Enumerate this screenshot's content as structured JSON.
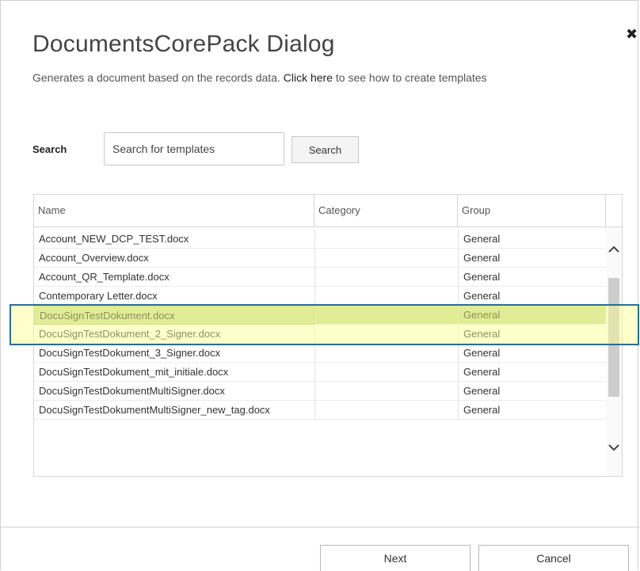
{
  "dialog": {
    "title": "DocumentsCorePack Dialog",
    "subtitle_before": "Generates a document based on the records data.",
    "subtitle_link": "Click here",
    "subtitle_after": "to see how to create templates",
    "close_symbol": "✖"
  },
  "search": {
    "label": "Search",
    "placeholder": "Search for templates",
    "button_label": "Search"
  },
  "grid": {
    "columns": [
      "Name",
      "Category",
      "Group"
    ],
    "rows": [
      {
        "name": "Account_NEW_DCP_TEST.docx",
        "category": "",
        "group": "General"
      },
      {
        "name": "Account_Overview.docx",
        "category": "",
        "group": "General"
      },
      {
        "name": "Account_QR_Template.docx",
        "category": "",
        "group": "General"
      },
      {
        "name": "Contemporary Letter.docx",
        "category": "",
        "group": "General"
      },
      {
        "name": "DocuSignTestDokument.docx",
        "category": "",
        "group": "General",
        "selected": true
      },
      {
        "name": "DocuSignTestDokument_2_Signer.docx",
        "category": "",
        "group": "General"
      },
      {
        "name": "DocuSignTestDokument_3_Signer.docx",
        "category": "",
        "group": "General"
      },
      {
        "name": "DocuSignTestDokument_mit_initiale.docx",
        "category": "",
        "group": "General"
      },
      {
        "name": "DocuSignTestDokumentMultiSigner.docx",
        "category": "",
        "group": "General"
      },
      {
        "name": "DocuSignTestDokumentMultiSigner_new_tag.docx",
        "category": "",
        "group": "General"
      }
    ]
  },
  "footer": {
    "next_label": "Next",
    "cancel_label": "Cancel"
  },
  "colors": {
    "selected_row": "#c8df9f",
    "highlight_border": "#2a6e93",
    "highlight_fill": "#ffff8c"
  },
  "icons": {
    "close": "close-icon",
    "scroll_up": "chevron-up-icon",
    "scroll_down": "chevron-down-icon"
  }
}
